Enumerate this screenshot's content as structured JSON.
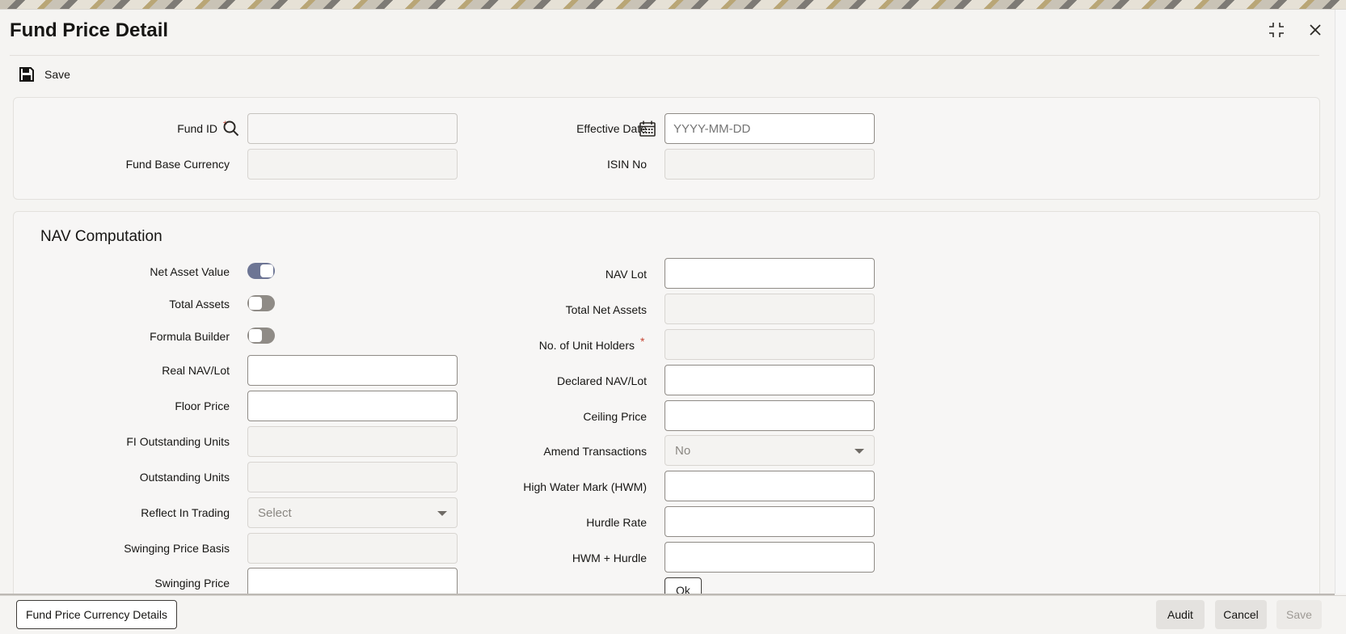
{
  "window": {
    "title": "Fund Price Detail",
    "maximize_icon": "maximize-icon",
    "close_icon": "close-icon"
  },
  "toolbar": {
    "save_label": "Save",
    "save_icon": "floppy-disk-icon"
  },
  "header_fields": {
    "fund_id": {
      "label": "Fund ID",
      "required_mark": "*",
      "value": "",
      "icon": "search-icon"
    },
    "fund_base_currency": {
      "label": "Fund Base Currency",
      "value": ""
    },
    "effective_date": {
      "label": "Effective Date",
      "placeholder": "YYYY-MM-DD",
      "icon": "calendar-icon"
    },
    "isin_no": {
      "label": "ISIN No",
      "value": ""
    }
  },
  "nav_section": {
    "title": "NAV Computation",
    "left": {
      "net_asset_value": {
        "label": "Net Asset Value",
        "checked": true
      },
      "total_assets": {
        "label": "Total Assets",
        "checked": false
      },
      "formula_builder": {
        "label": "Formula Builder",
        "checked": false
      },
      "real_nav_lot": {
        "label": "Real NAV/Lot",
        "value": ""
      },
      "floor_price": {
        "label": "Floor Price",
        "value": ""
      },
      "fi_outstanding_units": {
        "label": "FI Outstanding Units",
        "value": ""
      },
      "outstanding_units": {
        "label": "Outstanding Units",
        "value": ""
      },
      "reflect_in_trading": {
        "label": "Reflect In Trading",
        "selected": "Select"
      },
      "swinging_price_basis": {
        "label": "Swinging Price Basis",
        "value": ""
      },
      "swinging_price": {
        "label": "Swinging Price",
        "value": ""
      }
    },
    "right": {
      "nav_lot": {
        "label": "NAV Lot",
        "value": ""
      },
      "total_net_assets": {
        "label": "Total Net Assets",
        "value": ""
      },
      "no_of_unit_holders": {
        "label": "No. of Unit Holders",
        "required_mark": "*",
        "value": ""
      },
      "declared_nav_lot": {
        "label": "Declared NAV/Lot",
        "value": ""
      },
      "ceiling_price": {
        "label": "Ceiling Price",
        "value": ""
      },
      "amend_transactions": {
        "label": "Amend Transactions",
        "selected": "No"
      },
      "high_water_mark": {
        "label": "High Water Mark (HWM)",
        "value": ""
      },
      "hurdle_rate": {
        "label": "Hurdle Rate",
        "value": ""
      },
      "hwm_hurdle": {
        "label": "HWM + Hurdle",
        "value": ""
      },
      "ok_label": "Ok"
    }
  },
  "footer": {
    "currency_details_label": "Fund Price Currency Details",
    "audit_label": "Audit",
    "cancel_label": "Cancel",
    "save_label": "Save"
  }
}
